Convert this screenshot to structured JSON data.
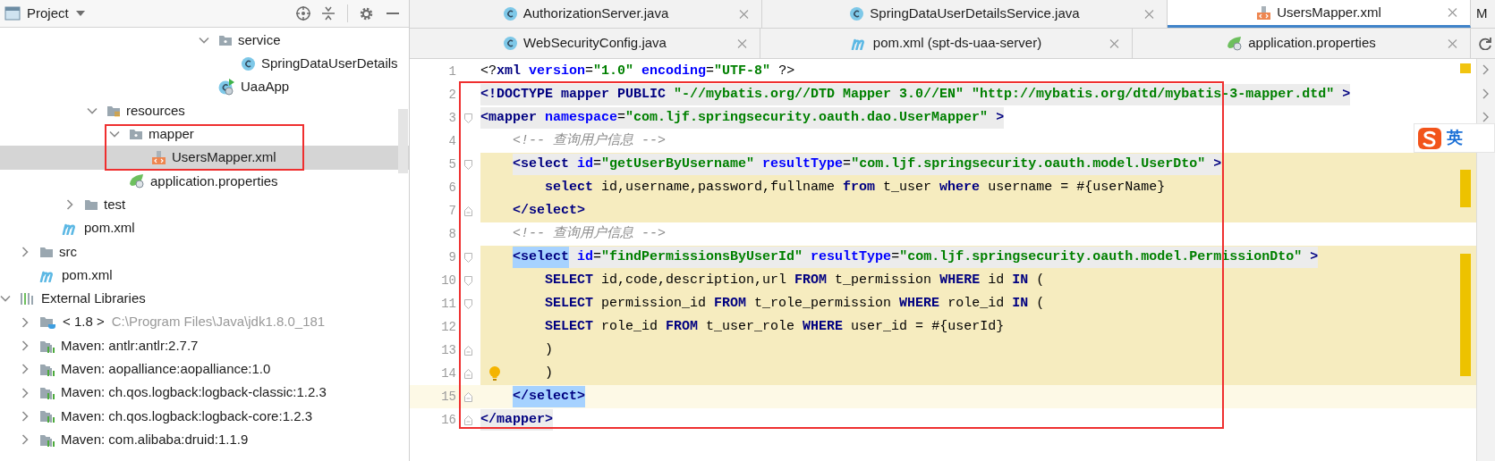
{
  "project_panel": {
    "title": "Project"
  },
  "tree": [
    {
      "children": [
        {
          "children": [
            {
              "children": [
                {
                  "children": [
                    {
                      "children": [
                        {
                          "children": [
                            {
                              "children": [
                                {
                                  "children": [
                                    {
                                      "children": [
                                        {
                                          "label": "service",
                                          "kind": "package",
                                          "expanded": true,
                                          "selected": false,
                                          "children": [
                                            {
                                              "label": "SpringDataUserDetails",
                                              "kind": "class",
                                              "selected": false
                                            }
                                          ]
                                        },
                                        {
                                          "label": "UaaApp",
                                          "kind": "app-class",
                                          "selected": false
                                        }
                                      ]
                                    }
                                  ]
                                }
                              ]
                            }
                          ]
                        }
                      ]
                    },
                    {
                      "label": "resources",
                      "kind": "resource-folder",
                      "expanded": true,
                      "selected": false,
                      "children": [
                        {
                          "label": "mapper",
                          "kind": "package",
                          "expanded": true,
                          "selected": false,
                          "children": [
                            {
                              "label": "UsersMapper.xml",
                              "kind": "xml-file",
                              "selected": true
                            }
                          ]
                        },
                        {
                          "label": "application.properties",
                          "kind": "properties-file",
                          "selected": false
                        }
                      ]
                    }
                  ]
                },
                {
                  "label": "test",
                  "kind": "folder",
                  "expanded": false,
                  "selected": false
                }
              ]
            },
            {
              "label": "pom.xml",
              "kind": "maven-file",
              "selected": false
            }
          ]
        },
        {
          "label": "src",
          "kind": "folder",
          "expanded": false,
          "selected": false
        },
        {
          "label": "pom.xml",
          "kind": "maven-file",
          "selected": false
        }
      ]
    },
    {
      "label": "External Libraries",
      "kind": "libraries",
      "expanded": true,
      "selected": false,
      "children": [
        {
          "label": "< 1.8 >",
          "detail": "C:\\Program Files\\Java\\jdk1.8.0_181",
          "kind": "jdk",
          "expanded": false,
          "selected": false
        },
        {
          "label": "Maven: antlr:antlr:2.7.7",
          "kind": "library",
          "expanded": false,
          "selected": false
        },
        {
          "label": "Maven: aopalliance:aopalliance:1.0",
          "kind": "library",
          "expanded": false,
          "selected": false
        },
        {
          "label": "Maven: ch.qos.logback:logback-classic:1.2.3",
          "kind": "library",
          "expanded": false,
          "selected": false
        },
        {
          "label": "Maven: ch.qos.logback:logback-core:1.2.3",
          "kind": "library",
          "expanded": false,
          "selected": false
        },
        {
          "label": "Maven: com.alibaba:druid:1.1.9",
          "kind": "library",
          "expanded": false,
          "selected": false
        }
      ]
    }
  ],
  "tab_rows": [
    [
      {
        "label": "AuthorizationServer.java",
        "kind": "class",
        "selected": false
      },
      {
        "label": "SpringDataUserDetailsService.java",
        "kind": "class",
        "selected": false
      },
      {
        "label": "UsersMapper.xml",
        "kind": "xml-file",
        "selected": true
      },
      {
        "label": "M",
        "kind": "partial",
        "selected": false
      }
    ],
    [
      {
        "label": "WebSecurityConfig.java",
        "kind": "class",
        "selected": false
      },
      {
        "label": "pom.xml (spt-ds-uaa-server)",
        "kind": "maven-file",
        "selected": false
      },
      {
        "label": "application.properties",
        "kind": "properties-file",
        "selected": false
      }
    ]
  ],
  "editor": {
    "lines": [
      {
        "number": "1",
        "segments": [
          {
            "kind": "punct",
            "text": "<?"
          },
          {
            "kind": "tag",
            "text": "xml "
          },
          {
            "kind": "attr",
            "text": "version"
          },
          {
            "kind": "text",
            "text": "="
          },
          {
            "kind": "value",
            "text": "\"1.0\" "
          },
          {
            "kind": "attr",
            "text": "encoding"
          },
          {
            "kind": "text",
            "text": "="
          },
          {
            "kind": "value",
            "text": "\"UTF-8\" "
          },
          {
            "kind": "punct",
            "text": "?>"
          }
        ]
      },
      {
        "number": "2",
        "tag_highlight": true,
        "segments": [
          {
            "kind": "tag",
            "text": "<!DOCTYPE mapper PUBLIC "
          },
          {
            "kind": "value",
            "text": "\"-//mybatis.org//DTD Mapper 3.0//EN\" "
          },
          {
            "kind": "value",
            "text": "\"http://mybatis.org/dtd/mybatis-3-mapper.dtd\" "
          },
          {
            "kind": "tag",
            "text": ">"
          }
        ]
      },
      {
        "number": "3",
        "tag_highlight": true,
        "fold_start": true,
        "segments": [
          {
            "kind": "tag",
            "text": "<mapper "
          },
          {
            "kind": "attr",
            "text": "namespace"
          },
          {
            "kind": "text",
            "text": "="
          },
          {
            "kind": "value",
            "text": "\"com.ljf.springsecurity.oauth.dao.UserMapper\" "
          },
          {
            "kind": "tag",
            "text": ">"
          }
        ]
      },
      {
        "number": "4",
        "segments": [
          {
            "kind": "comment",
            "text": "    <!-- 查询用户信息 -->"
          }
        ]
      },
      {
        "number": "5",
        "tag_highlight": true,
        "injected": true,
        "fold_start": true,
        "segments": [
          {
            "kind": "tag",
            "text": "    <select "
          },
          {
            "kind": "attr",
            "text": "id"
          },
          {
            "kind": "text",
            "text": "="
          },
          {
            "kind": "value",
            "text": "\"getUserByUsername\" "
          },
          {
            "kind": "attr",
            "text": "resultType"
          },
          {
            "kind": "text",
            "text": "="
          },
          {
            "kind": "value",
            "text": "\"com.ljf.springsecurity.oauth.model.UserDto\" "
          },
          {
            "kind": "tag",
            "text": ">"
          }
        ]
      },
      {
        "number": "6",
        "injected": true,
        "segments": [
          {
            "kind": "keyword",
            "text": "        select"
          },
          {
            "kind": "text",
            "text": " id,username,password,fullname "
          },
          {
            "kind": "keyword",
            "text": "from"
          },
          {
            "kind": "text",
            "text": " t_user "
          },
          {
            "kind": "keyword",
            "text": "where"
          },
          {
            "kind": "text",
            "text": " username = #{userName}"
          }
        ]
      },
      {
        "number": "7",
        "injected": true,
        "fold_end": true,
        "segments": [
          {
            "kind": "tag",
            "text": "    </select>"
          }
        ]
      },
      {
        "number": "8",
        "segments": [
          {
            "kind": "comment",
            "text": "    <!-- 查询用户信息 -->"
          }
        ]
      },
      {
        "number": "9",
        "tag_highlight": true,
        "injected": true,
        "fold_start": true,
        "segments": [
          {
            "kind": "tag",
            "text": "    <select",
            "match": true
          },
          {
            "kind": "attr",
            "text": " id"
          },
          {
            "kind": "text",
            "text": "="
          },
          {
            "kind": "value",
            "text": "\"findPermissionsByUserId\" "
          },
          {
            "kind": "attr",
            "text": "resultType"
          },
          {
            "kind": "text",
            "text": "="
          },
          {
            "kind": "value",
            "text": "\"com.ljf.springsecurity.oauth.model.PermissionDto\" "
          },
          {
            "kind": "tag",
            "text": ">"
          }
        ]
      },
      {
        "number": "10",
        "injected": true,
        "fold_start": true,
        "segments": [
          {
            "kind": "keyword",
            "text": "        SELECT"
          },
          {
            "kind": "text",
            "text": " id,code,description,url "
          },
          {
            "kind": "keyword",
            "text": "FROM"
          },
          {
            "kind": "text",
            "text": " t_permission "
          },
          {
            "kind": "keyword",
            "text": "WHERE"
          },
          {
            "kind": "text",
            "text": " id "
          },
          {
            "kind": "keyword",
            "text": "IN"
          },
          {
            "kind": "text",
            "text": " ("
          }
        ]
      },
      {
        "number": "11",
        "injected": true,
        "fold_start": true,
        "segments": [
          {
            "kind": "keyword",
            "text": "        SELECT"
          },
          {
            "kind": "text",
            "text": " permission_id "
          },
          {
            "kind": "keyword",
            "text": "FROM"
          },
          {
            "kind": "text",
            "text": " t_role_permission "
          },
          {
            "kind": "keyword",
            "text": "WHERE"
          },
          {
            "kind": "text",
            "text": " role_id "
          },
          {
            "kind": "keyword",
            "text": "IN"
          },
          {
            "kind": "text",
            "text": " ("
          }
        ]
      },
      {
        "number": "12",
        "injected": true,
        "segments": [
          {
            "kind": "keyword",
            "text": "        SELECT"
          },
          {
            "kind": "text",
            "text": " role_id "
          },
          {
            "kind": "keyword",
            "text": "FROM"
          },
          {
            "kind": "text",
            "text": " t_user_role "
          },
          {
            "kind": "keyword",
            "text": "WHERE"
          },
          {
            "kind": "text",
            "text": " user_id = #{userId}"
          }
        ]
      },
      {
        "number": "13",
        "injected": true,
        "fold_end": true,
        "segments": [
          {
            "kind": "text",
            "text": "        )"
          }
        ]
      },
      {
        "number": "14",
        "injected": true,
        "fold_end": true,
        "intention_bulb": true,
        "segments": [
          {
            "kind": "text",
            "text": "        )"
          }
        ]
      },
      {
        "number": "15",
        "caret": true,
        "fold_end": true,
        "segments": [
          {
            "kind": "tag",
            "text": "    </select>",
            "match": true
          }
        ]
      },
      {
        "number": "16",
        "tag_highlight": true,
        "fold_end": true,
        "segments": [
          {
            "kind": "tag",
            "text": "</mapper>"
          }
        ]
      }
    ]
  },
  "ime_indicator": {
    "label": "英"
  }
}
